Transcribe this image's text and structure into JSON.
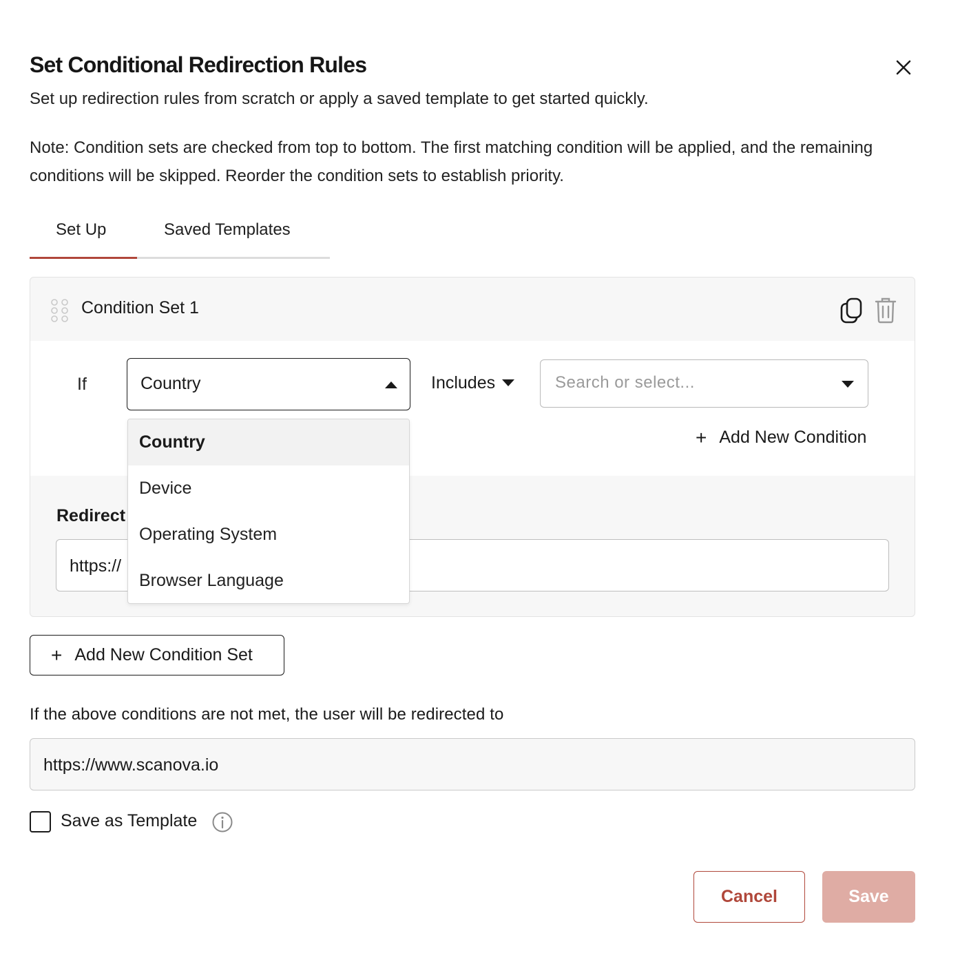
{
  "dialog": {
    "title": "Set Conditional Redirection Rules",
    "subtitle": "Set up redirection rules from scratch or apply a saved template to get started quickly.",
    "note": "Note: Condition sets are checked from top to bottom. The first matching condition will be applied, and the remaining conditions will be skipped. Reorder the condition sets to establish priority.",
    "close_icon": "close-icon"
  },
  "tabs": [
    {
      "label": "Set Up",
      "active": true
    },
    {
      "label": "Saved Templates",
      "active": false
    }
  ],
  "condition_set": {
    "title": "Condition Set 1",
    "if_label": "If",
    "field": {
      "value": "Country",
      "expanded": true
    },
    "operator": "Includes",
    "value_select": {
      "placeholder": "Search or select...",
      "value": ""
    },
    "add_condition_label": "Add New Condition",
    "redirect_label": "Redirect",
    "redirect_value": "https://"
  },
  "field_options": [
    {
      "label": "Country",
      "selected": true
    },
    {
      "label": "Device",
      "selected": false
    },
    {
      "label": "Operating System",
      "selected": false
    },
    {
      "label": "Browser Language",
      "selected": false
    }
  ],
  "add_condition_set_label": "Add New Condition Set",
  "fallback": {
    "label": "If the above conditions are not met, the user will be redirected to",
    "value": "https://www.scanova.io"
  },
  "save_template": {
    "label": "Save as Template",
    "checked": false
  },
  "actions": {
    "cancel_label": "Cancel",
    "save_label": "Save"
  },
  "colors": {
    "accent": "#b0473a",
    "save_disabled": "#dfaca4"
  }
}
